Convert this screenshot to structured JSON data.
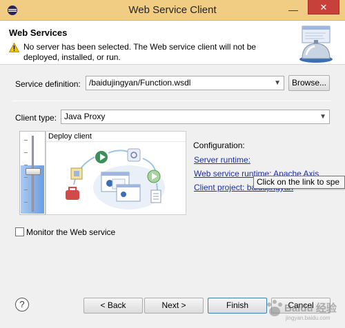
{
  "window": {
    "title": "Web Service Client",
    "minimize_glyph": "—",
    "close_glyph": "✕"
  },
  "header": {
    "title": "Web Services",
    "warning": "No server has been selected. The Web service client will not be deployed, installed, or run."
  },
  "service_definition": {
    "label": "Service definition:",
    "value": "/baidujingyan/Function.wsdl",
    "browse_label": "Browse..."
  },
  "client_type": {
    "label": "Client type:",
    "value": "Java Proxy"
  },
  "slider": {
    "level_percent": 58
  },
  "preview": {
    "title": "Deploy client"
  },
  "configuration": {
    "label": "Configuration:",
    "server_runtime": "Server runtime:",
    "web_service_runtime": "Web service runtime: Apache Axis",
    "client_project": "Client project: baidujingyan",
    "tooltip": "Click on the link to spe"
  },
  "monitor": {
    "label": "Monitor the Web service",
    "checked": false
  },
  "footer": {
    "back_label": "< Back",
    "next_label": "Next >",
    "finish_label": "Finish",
    "cancel_label": "Cancel"
  },
  "icons": {
    "app": "eclipse-icon",
    "warning": "warning-icon",
    "help": "help-icon"
  },
  "watermark": {
    "text": "Baidu 经验",
    "subtext": "jingyan.baidu.com"
  }
}
